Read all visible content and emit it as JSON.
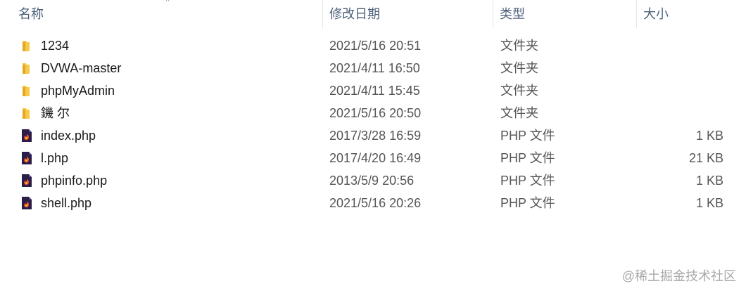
{
  "columns": {
    "name": "名称",
    "date": "修改日期",
    "type": "类型",
    "size": "大小"
  },
  "sort_indicator": "^",
  "files": [
    {
      "name": "1234",
      "date": "2021/5/16 20:51",
      "type": "文件夹",
      "size": "",
      "icon": "folder-icon"
    },
    {
      "name": "DVWA-master",
      "date": "2021/4/11 16:50",
      "type": "文件夹",
      "size": "",
      "icon": "folder-icon"
    },
    {
      "name": "phpMyAdmin",
      "date": "2021/4/11 15:45",
      "type": "文件夹",
      "size": "",
      "icon": "folder-icon"
    },
    {
      "name": "鐖  尔",
      "date": "2021/5/16 20:50",
      "type": "文件夹",
      "size": "",
      "icon": "folder-icon"
    },
    {
      "name": "index.php",
      "date": "2017/3/28 16:59",
      "type": "PHP 文件",
      "size": "1 KB",
      "icon": "php-file-icon"
    },
    {
      "name": "l.php",
      "date": "2017/4/20 16:49",
      "type": "PHP 文件",
      "size": "21 KB",
      "icon": "php-file-icon"
    },
    {
      "name": "phpinfo.php",
      "date": "2013/5/9 20:56",
      "type": "PHP 文件",
      "size": "1 KB",
      "icon": "php-file-icon"
    },
    {
      "name": "shell.php",
      "date": "2021/5/16 20:26",
      "type": "PHP 文件",
      "size": "1 KB",
      "icon": "php-file-icon"
    }
  ],
  "watermark": "@稀土掘金技术社区",
  "colors": {
    "header_text": "#4c607a",
    "folder": "#f7c948",
    "php_icon_bg": "#2b1d4a"
  }
}
